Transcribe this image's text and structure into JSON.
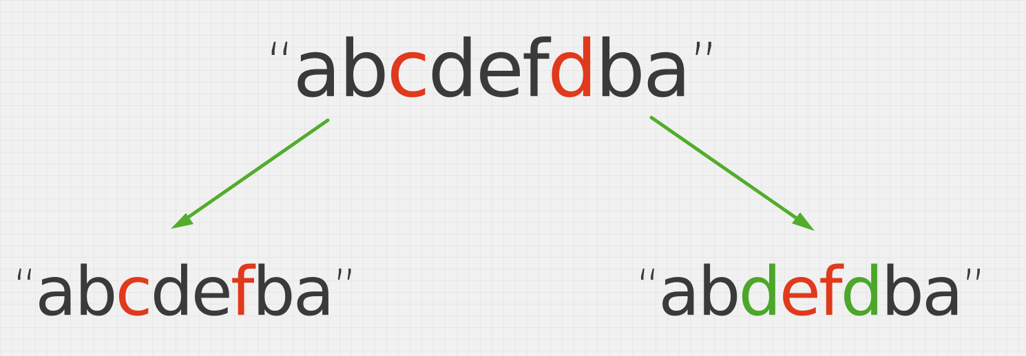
{
  "colors": {
    "text": "#3a3a3a",
    "highlight_red": "#e0391c",
    "highlight_green": "#4ba72a",
    "arrow": "#51ad2b",
    "background": "#f1f1f1"
  },
  "strings": {
    "top": {
      "open_quote": "“",
      "close_quote": "”",
      "chars": [
        {
          "ch": "a",
          "color": "text"
        },
        {
          "ch": "b",
          "color": "text"
        },
        {
          "ch": "c",
          "color": "highlight_red"
        },
        {
          "ch": "d",
          "color": "text"
        },
        {
          "ch": "e",
          "color": "text"
        },
        {
          "ch": "f",
          "color": "text"
        },
        {
          "ch": "d",
          "color": "highlight_red"
        },
        {
          "ch": "b",
          "color": "text"
        },
        {
          "ch": "a",
          "color": "text"
        }
      ]
    },
    "left": {
      "open_quote": "“",
      "close_quote": "”",
      "chars": [
        {
          "ch": "a",
          "color": "text"
        },
        {
          "ch": "b",
          "color": "text"
        },
        {
          "ch": "c",
          "color": "highlight_red"
        },
        {
          "ch": "d",
          "color": "text"
        },
        {
          "ch": "e",
          "color": "text"
        },
        {
          "ch": "f",
          "color": "highlight_red"
        },
        {
          "ch": "b",
          "color": "text"
        },
        {
          "ch": "a",
          "color": "text"
        }
      ]
    },
    "right": {
      "open_quote": "“",
      "close_quote": "”",
      "chars": [
        {
          "ch": "a",
          "color": "text"
        },
        {
          "ch": "b",
          "color": "text"
        },
        {
          "ch": "d",
          "color": "highlight_green"
        },
        {
          "ch": "e",
          "color": "highlight_red"
        },
        {
          "ch": "f",
          "color": "highlight_red"
        },
        {
          "ch": "d",
          "color": "highlight_green"
        },
        {
          "ch": "b",
          "color": "text"
        },
        {
          "ch": "a",
          "color": "text"
        }
      ]
    }
  },
  "arrows": [
    {
      "name": "arrow-to-left",
      "from": "top",
      "to": "left"
    },
    {
      "name": "arrow-to-right",
      "from": "top",
      "to": "right"
    }
  ]
}
